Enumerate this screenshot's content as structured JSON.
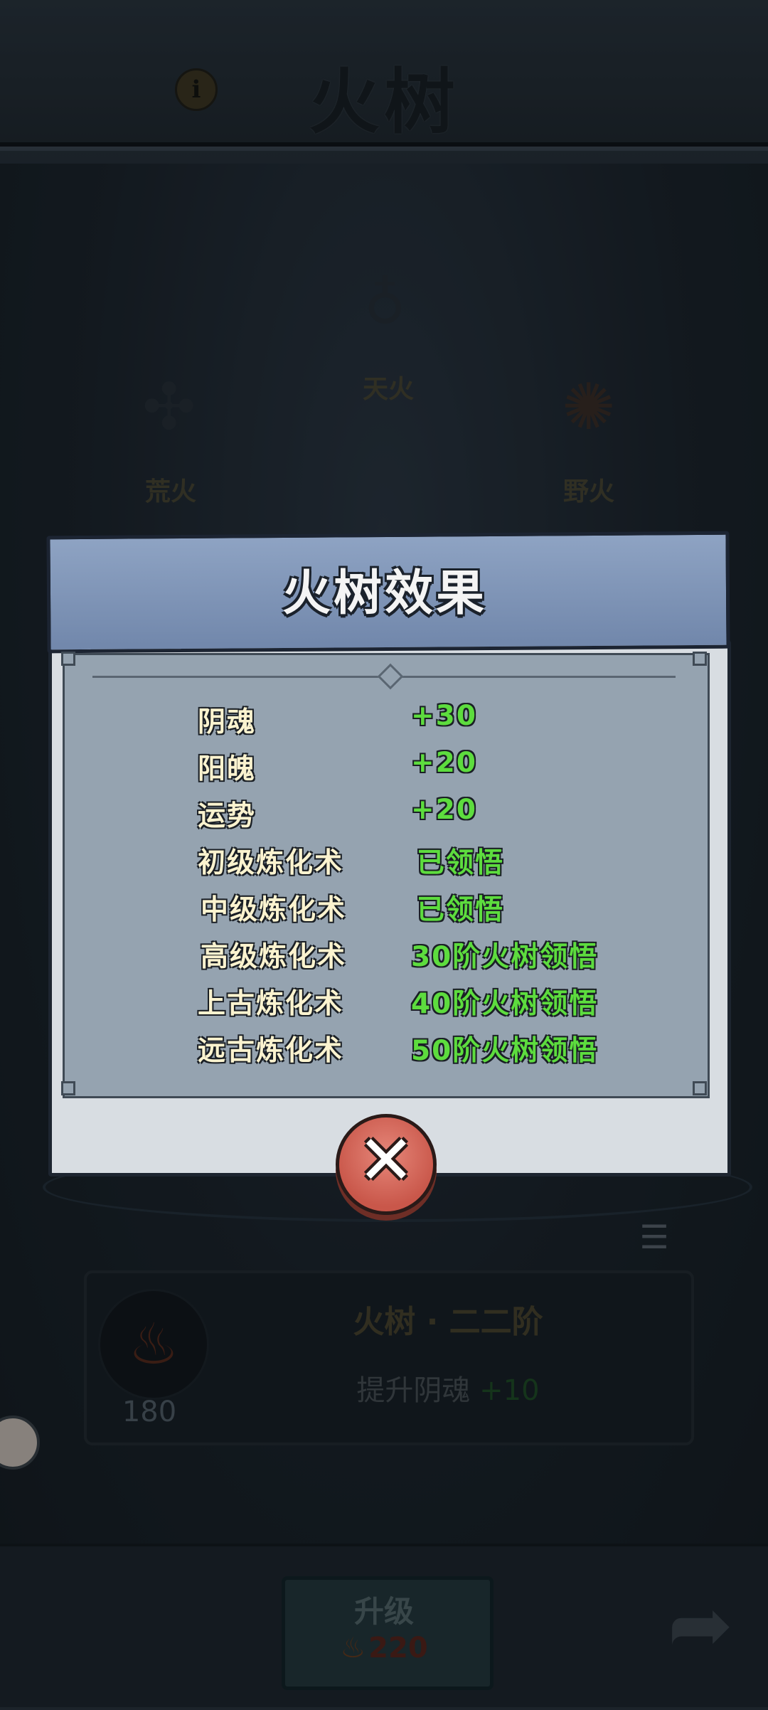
{
  "header": {
    "title": "火树",
    "info_icon": "i"
  },
  "tree_labels": {
    "top": "天火",
    "left": "荒火",
    "right": "野火"
  },
  "level_card": {
    "title": "火树 · 二二阶",
    "desc_prefix": "提升阴魂",
    "desc_value": "+10",
    "count": "180"
  },
  "upgrade": {
    "label": "升级",
    "cost": "220"
  },
  "dialog": {
    "title": "火树效果",
    "rows": [
      {
        "name": "阴魂",
        "value": "+30"
      },
      {
        "name": "阳魄",
        "value": "+20"
      },
      {
        "name": "运势",
        "value": "+20"
      },
      {
        "name": "初级炼化术",
        "value": "已领悟"
      },
      {
        "name": "中级炼化术",
        "value": "已领悟"
      },
      {
        "name": "高级炼化术",
        "value": "30阶火树领悟"
      },
      {
        "name": "上古炼化术",
        "value": "40阶火树领悟"
      },
      {
        "name": "远古炼化术",
        "value": "50阶火树领悟"
      }
    ]
  },
  "colors": {
    "effect_green": "#5ddc3e",
    "row_label": "#fbf3cf",
    "dialog_header": "#8ea3c3",
    "close_red": "#c9574a"
  }
}
